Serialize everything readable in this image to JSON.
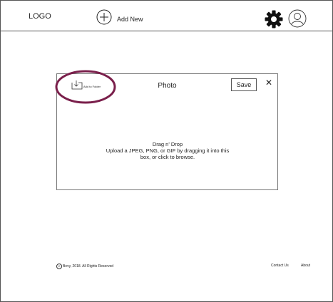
{
  "header": {
    "logo": "LOGO",
    "add_new_label": "Add New",
    "settings_icon": "gear-icon",
    "profile_icon": "user-avatar-icon"
  },
  "modal": {
    "title": "Photo",
    "add_to_folder_label": "Add to Folder",
    "save_label": "Save",
    "close_label": "✕",
    "dropzone": {
      "title": "Drag n' Drop",
      "line1": "Upload a JPEG, PNG, or GIF by dragging it into this",
      "line2": "box, or click to browse."
    },
    "highlight_color": "#7a1f4b"
  },
  "footer": {
    "copyright_symbol": "C",
    "copyright_text": "Bevy, 2018. All Rights Reserved",
    "links": [
      "Contact Us",
      "About"
    ]
  }
}
